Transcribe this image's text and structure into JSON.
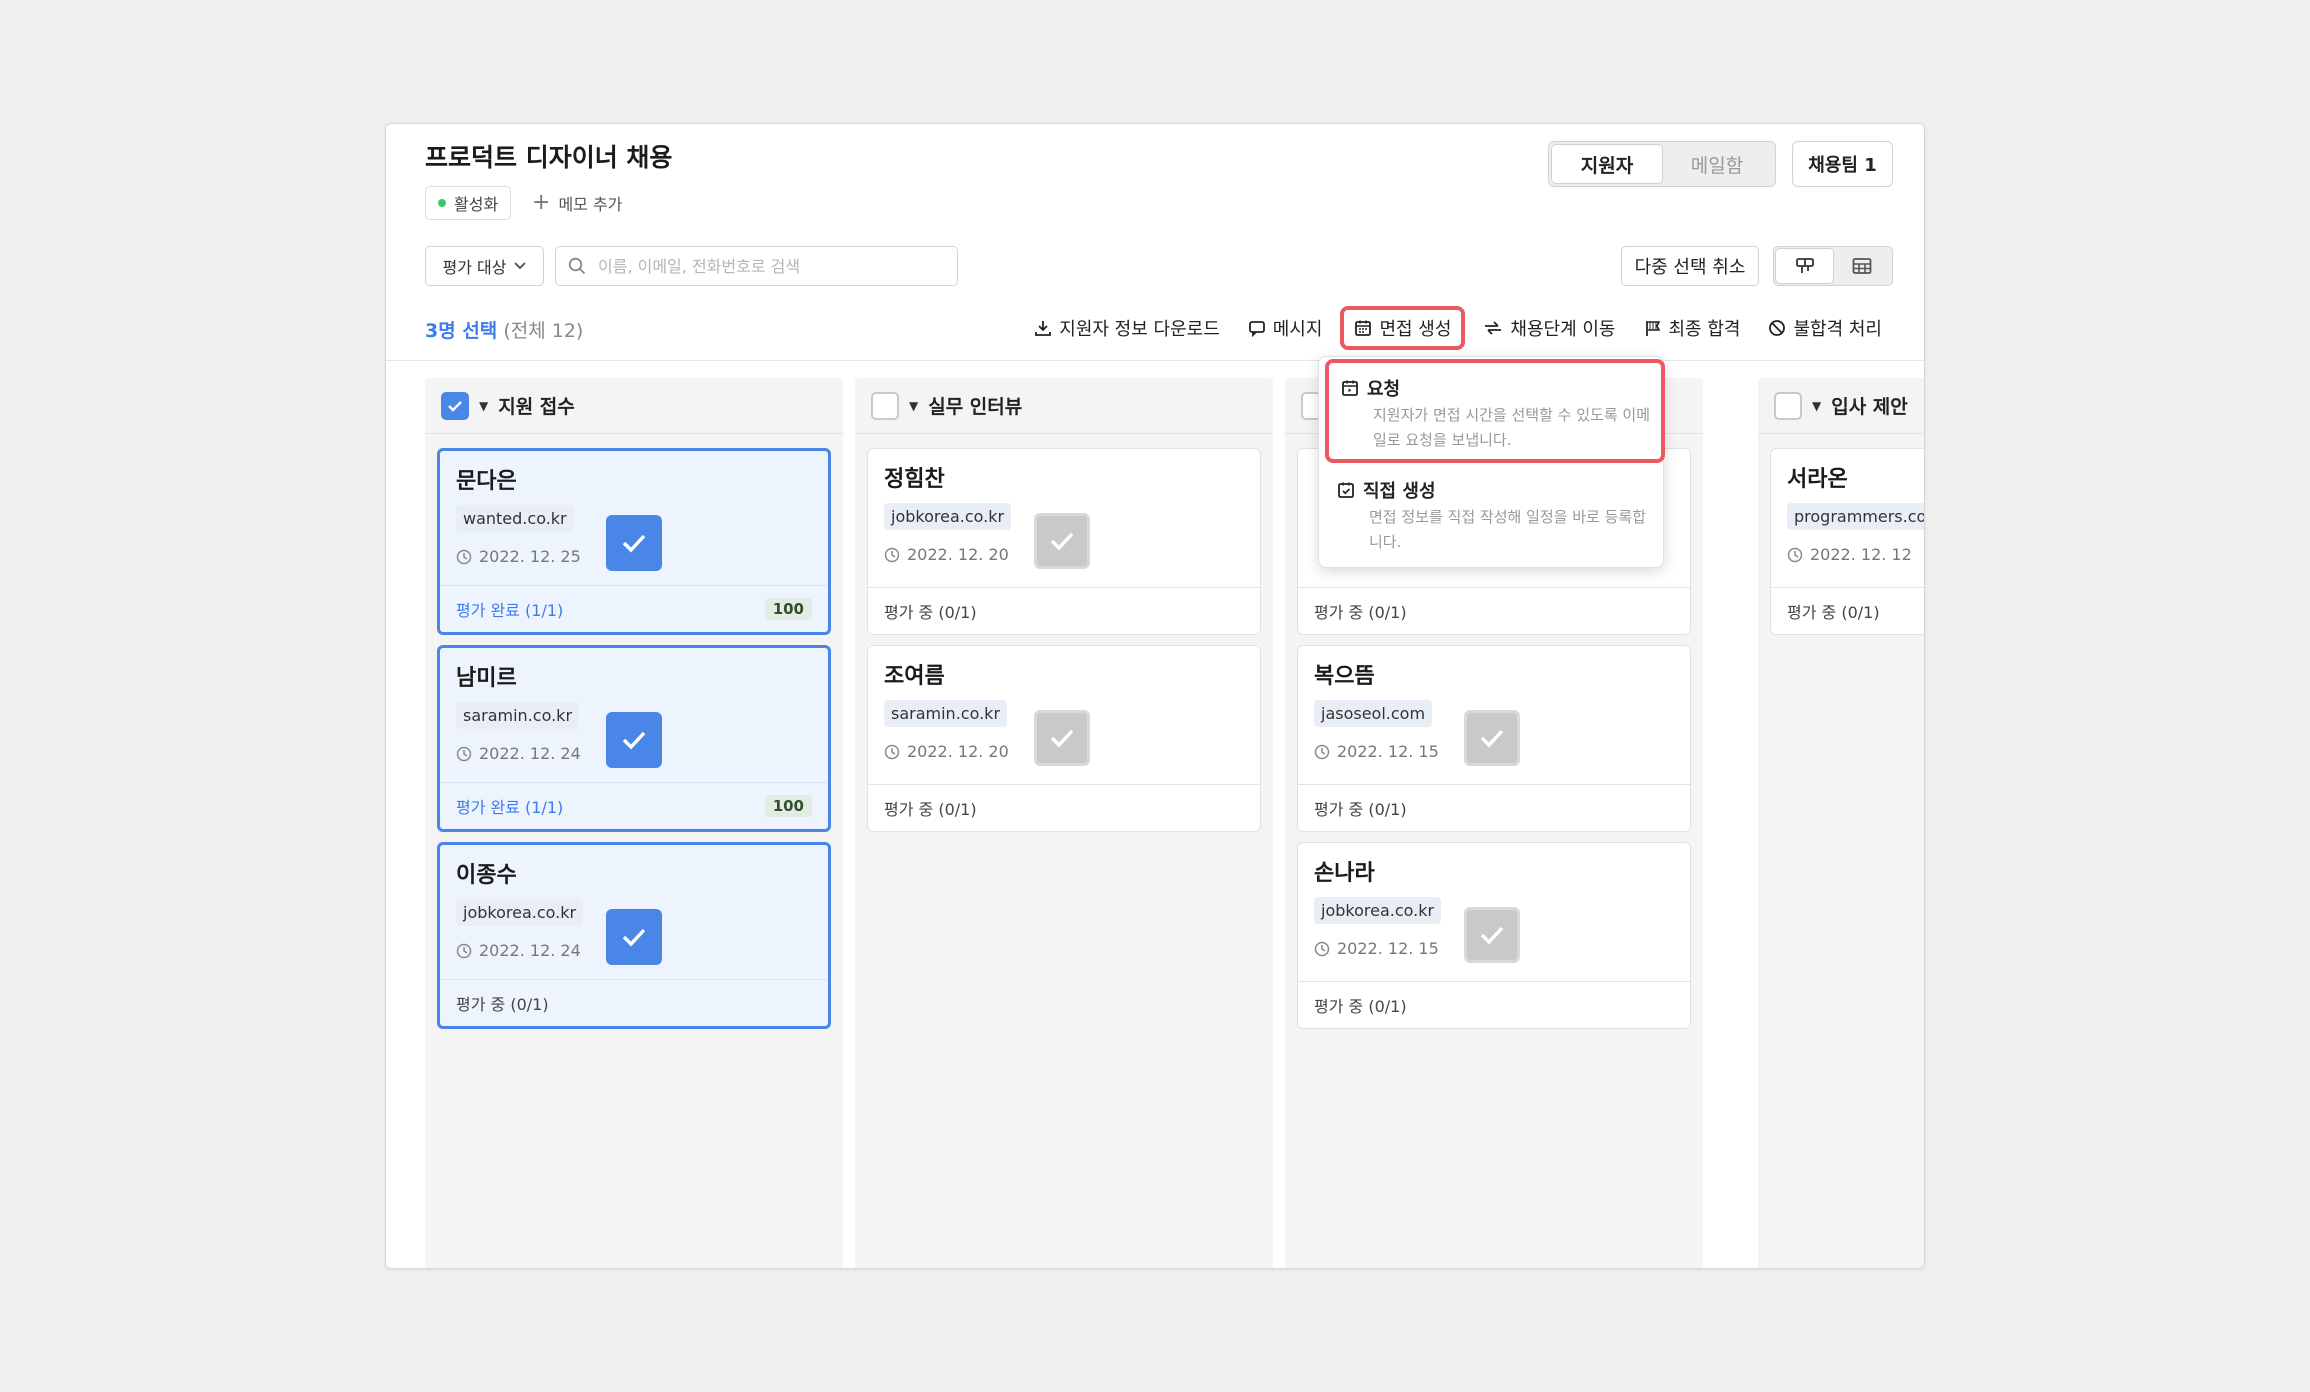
{
  "header": {
    "title": "프로덕트 디자이너 채용",
    "status": "활성화",
    "memo_add": "메모 추가",
    "view_tabs": [
      "지원자",
      "메일함"
    ],
    "team_button": "채용팀 1"
  },
  "toolbar": {
    "filter_label": "평가 대상",
    "search_placeholder": "이름, 이메일, 전화번호로 검색",
    "multi_select_cancel": "다중 선택 취소"
  },
  "selection": {
    "count_label": "3명 선택",
    "total_label": "(전체 12)"
  },
  "actions": {
    "download": "지원자 정보 다운로드",
    "message": "메시지",
    "create_interview": "면접 생성",
    "move_stage": "채용단계 이동",
    "final_pass": "최종 합격",
    "reject": "불합격 처리"
  },
  "interview_menu": {
    "request": {
      "title": "요청",
      "desc": "지원자가 면접 시간을 선택할 수 있도록 이메일로 요청을 보냅니다."
    },
    "direct": {
      "title": "직접 생성",
      "desc": "면접 정보를 직접 작성해 일정을 바로 등록합니다."
    }
  },
  "colors": {
    "accent": "#4a86e8",
    "highlight": "#ea5a5f",
    "active_dot": "#3cc76a"
  },
  "columns": [
    {
      "title": "지원 접수",
      "checked": true,
      "cards": [
        {
          "name": "문다은",
          "source": "wanted.co.kr",
          "date": "2022. 12. 25",
          "eval": "평가 완료 (1/1)",
          "score": "100",
          "selected": true
        },
        {
          "name": "남미르",
          "source": "saramin.co.kr",
          "date": "2022. 12. 24",
          "eval": "평가 완료 (1/1)",
          "score": "100",
          "selected": true
        },
        {
          "name": "이종수",
          "source": "jobkorea.co.kr",
          "date": "2022. 12. 24",
          "eval": "평가 중 (0/1)",
          "score": "",
          "selected": true
        }
      ]
    },
    {
      "title": "실무 인터뷰",
      "checked": false,
      "cards": [
        {
          "name": "정힘찬",
          "source": "jobkorea.co.kr",
          "date": "2022. 12. 20",
          "eval": "평가 중 (0/1)",
          "score": "",
          "selected": false
        },
        {
          "name": "조여름",
          "source": "saramin.co.kr",
          "date": "2022. 12. 20",
          "eval": "평가 중 (0/1)",
          "score": "",
          "selected": false
        }
      ]
    },
    {
      "title": "",
      "checked": false,
      "cards": [
        {
          "name": "",
          "source": "",
          "date": "",
          "eval": "평가 중 (0/1)",
          "score": "",
          "selected": false
        },
        {
          "name": "복으뜸",
          "source": "jasoseol.com",
          "date": "2022. 12. 15",
          "eval": "평가 중 (0/1)",
          "score": "",
          "selected": false
        },
        {
          "name": "손나라",
          "source": "jobkorea.co.kr",
          "date": "2022. 12. 15",
          "eval": "평가 중 (0/1)",
          "score": "",
          "selected": false
        }
      ]
    },
    {
      "title": "입사 제안",
      "checked": false,
      "cards": [
        {
          "name": "서라온",
          "source": "programmers.co.",
          "date": "2022. 12. 12",
          "eval": "평가 중 (0/1)",
          "score": "",
          "selected": false
        }
      ]
    }
  ]
}
